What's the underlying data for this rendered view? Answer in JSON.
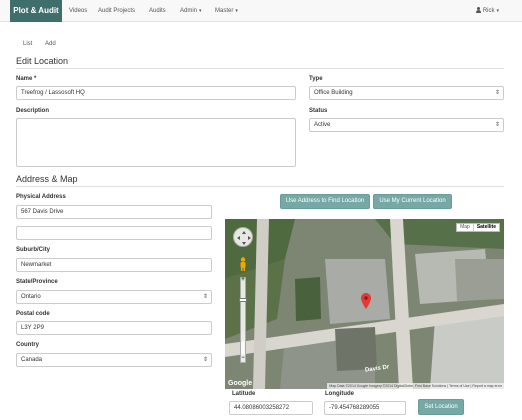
{
  "navbar": {
    "brand": "Plot & Audit",
    "items": [
      "Videos",
      "Audit Projects",
      "Audits",
      "Admin",
      "Master"
    ],
    "user": "Rick"
  },
  "subtabs": [
    "List",
    "Add"
  ],
  "edit": {
    "title": "Edit Location",
    "name_label": "Name *",
    "name_value": "Treefrog / Lassosoft HQ",
    "type_label": "Type",
    "type_value": "Office Building",
    "description_label": "Description",
    "description_value": "",
    "status_label": "Status",
    "status_value": "Active"
  },
  "address": {
    "title": "Address & Map",
    "physical_label": "Physical Address",
    "line1": "567 Davis Drive",
    "line2": "",
    "suburb_label": "Suburb/City",
    "suburb_value": "Newmarket",
    "state_label": "State/Province",
    "state_value": "Ontario",
    "postal_label": "Postal code",
    "postal_value": "L3Y 2P9",
    "country_label": "Country",
    "country_value": "Canada",
    "find_button": "Use Address to Find Location",
    "current_button": "Use My Current Location",
    "latitude_label": "Latitude",
    "latitude_value": "44.0808600325827​2",
    "longitude_label": "Longitude",
    "longitude_value": "-79.4547682890​55",
    "set_button": "Set Location"
  },
  "map": {
    "type_map": "Map",
    "type_satellite": "Satellite",
    "street_label": "Davis Dr",
    "logo": "Google",
    "footer": "Map Data ©2014 Google Imagery ©2014 DigitalGlobe, First Base Solutions | Terms of Use | Report a map error"
  },
  "colors": {
    "brand": "#3f6e6c",
    "button": "#76a9a6",
    "marker": "#e53935"
  }
}
